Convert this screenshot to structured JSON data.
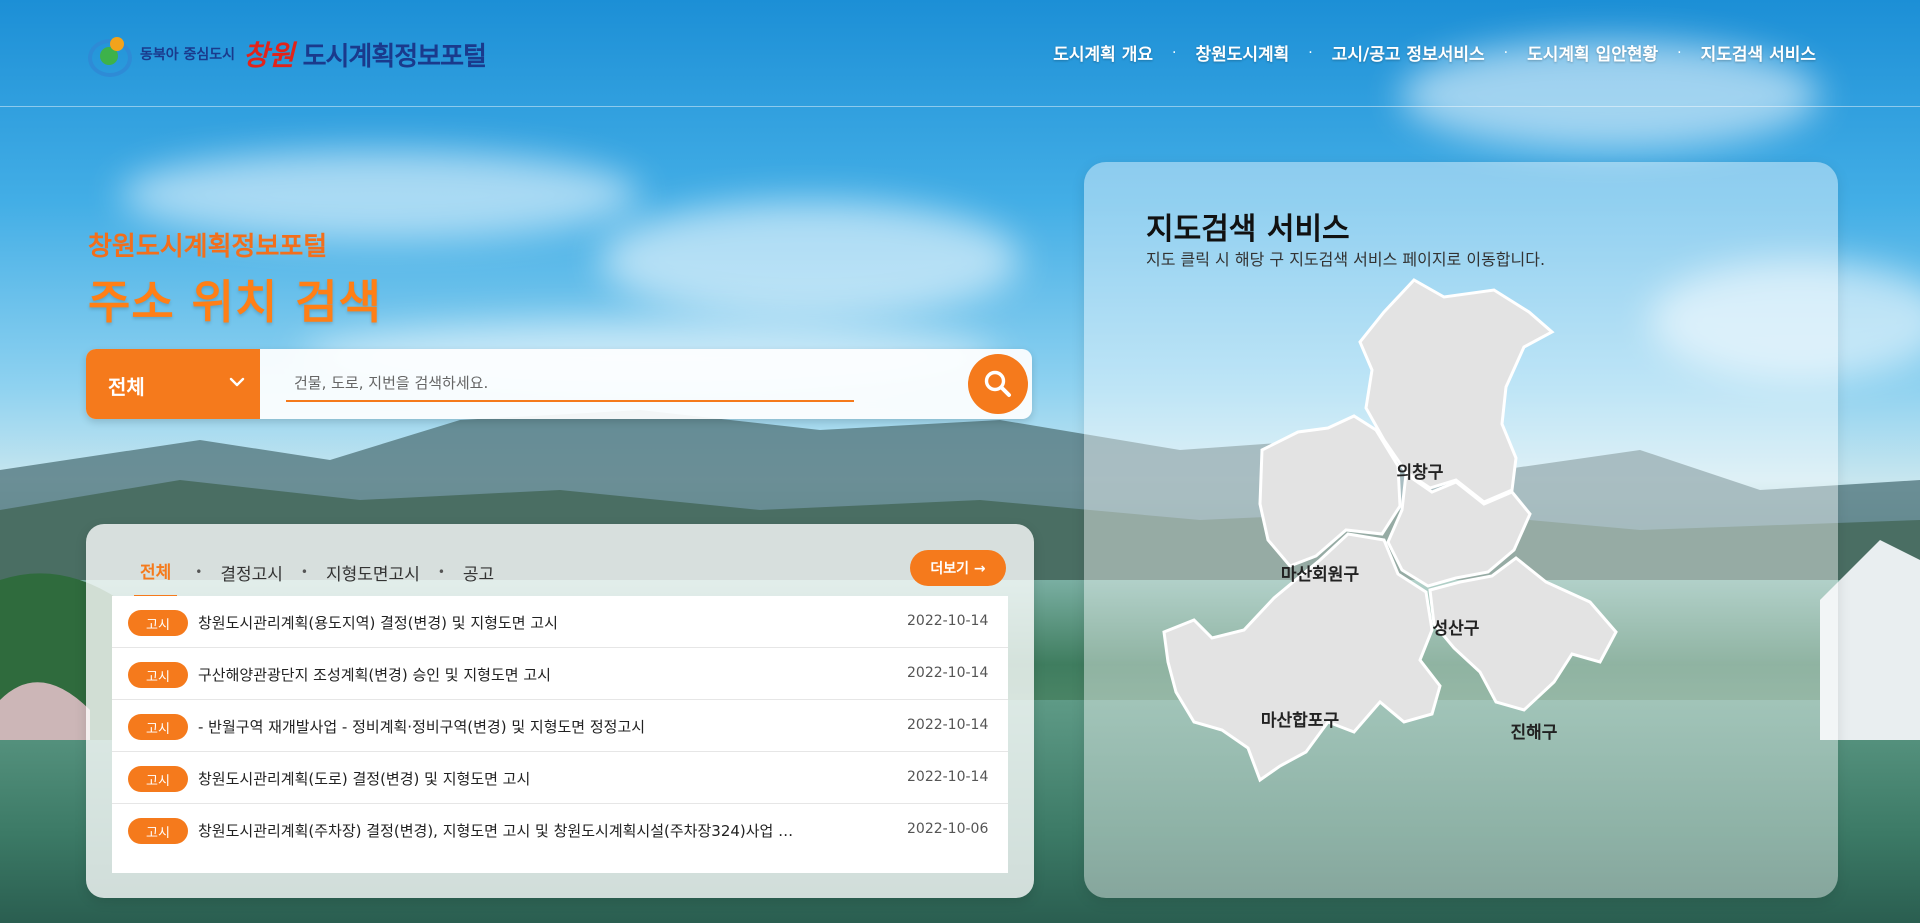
{
  "header": {
    "logo_sub": "동북아 중심도시",
    "logo_brand": "창원",
    "logo_title": "도시계획정보포털",
    "nav": [
      "도시계획 개요",
      "창원도시계획",
      "고시/공고 정보서비스",
      "도시계획 입안현황",
      "지도검색 서비스"
    ]
  },
  "hero": {
    "subtitle": "창원도시계획정보포털",
    "title": "주소 위치 검색"
  },
  "search": {
    "selected": "전체",
    "placeholder": "건물, 도로, 지번을 검색하세요."
  },
  "notices": {
    "tabs": [
      "전체",
      "결정고시",
      "지형도면고시",
      "공고"
    ],
    "more_label": "더보기 →",
    "rows": [
      {
        "badge": "고시",
        "title": "창원도시관리계획(용도지역) 결정(변경) 및 지형도면 고시",
        "date": "2022-10-14"
      },
      {
        "badge": "고시",
        "title": "구산해양관광단지 조성계획(변경) 승인 및 지형도면 고시",
        "date": "2022-10-14"
      },
      {
        "badge": "고시",
        "title": "- 반월구역 재개발사업 - 정비계획·정비구역(변경) 및 지형도면 정정고시",
        "date": "2022-10-14"
      },
      {
        "badge": "고시",
        "title": "창원도시관리계획(도로) 결정(변경) 및 지형도면 고시",
        "date": "2022-10-14"
      },
      {
        "badge": "고시",
        "title": "창원도시관리계획(주차장) 결정(변경), 지형도면 고시 및 창원도시계획시설(주차장324)사업 …",
        "date": "2022-10-06"
      }
    ]
  },
  "map": {
    "title": "지도검색 서비스",
    "description": "지도 클릭 시 해당 구 지도검색 서비스 페이지로 이동합니다.",
    "districts": [
      "의창구",
      "마산회원구",
      "성산구",
      "마산합포구",
      "진해구"
    ]
  },
  "colors": {
    "accent": "#f57a1c",
    "brand_blue": "#1a3a8c",
    "brand_red": "#e2231a",
    "district_fill": "#e3e3e3"
  }
}
